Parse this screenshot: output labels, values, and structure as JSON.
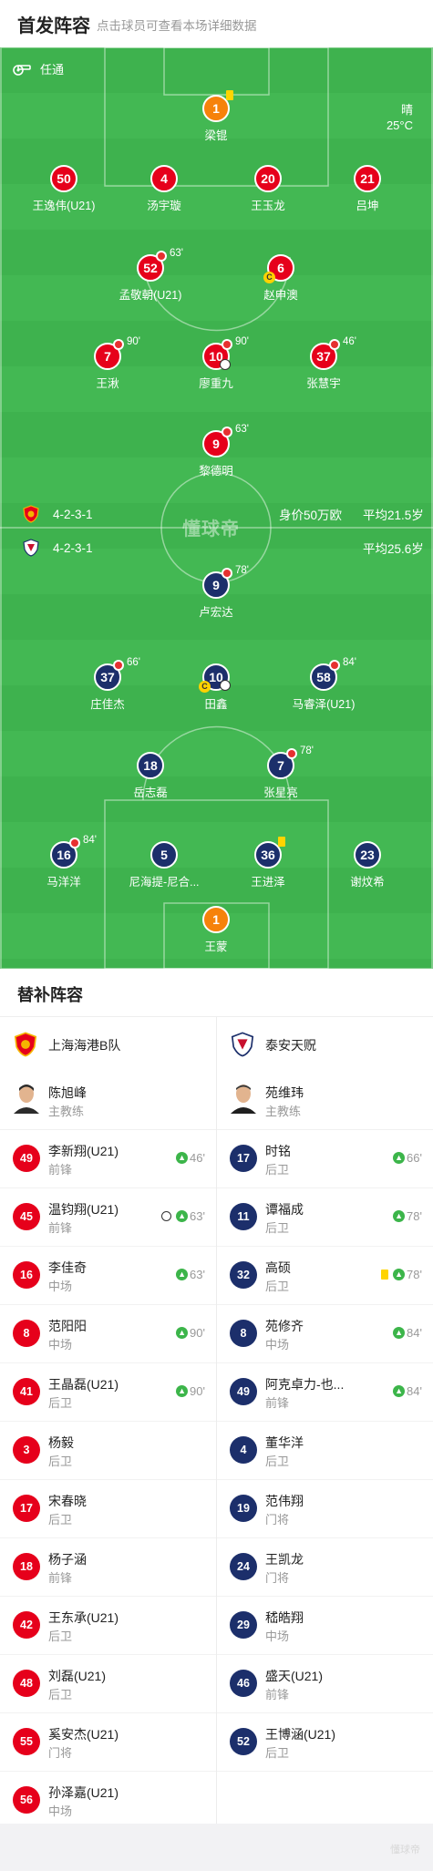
{
  "header": {
    "title": "首发阵容",
    "subtitle": "点击球员可查看本场详细数据"
  },
  "referee": {
    "icon": "whistle-icon",
    "name": "任通"
  },
  "weather": {
    "condition": "晴",
    "temperature": "25°C"
  },
  "watermark": "懂球帝",
  "home_team": {
    "formation": "4-2-3-1",
    "value": "身价50万欧",
    "avg_age": "平均21.5岁"
  },
  "away_team": {
    "formation": "4-2-3-1",
    "avg_age": "平均25.6岁"
  },
  "home_players": [
    {
      "num": "1",
      "name": "梁锟"
    },
    {
      "num": "50",
      "name": "王逸伟(U21)"
    },
    {
      "num": "4",
      "name": "汤宇璇"
    },
    {
      "num": "20",
      "name": "王玉龙"
    },
    {
      "num": "21",
      "name": "吕坤"
    },
    {
      "num": "52",
      "name": "孟敬朝(U21)",
      "sub": "63'"
    },
    {
      "num": "6",
      "name": "赵申澳"
    },
    {
      "num": "7",
      "name": "王湫",
      "sub": "90'"
    },
    {
      "num": "10",
      "name": "廖重九",
      "sub": "90'"
    },
    {
      "num": "37",
      "name": "张慧宇",
      "sub": "46'"
    },
    {
      "num": "9",
      "name": "黎德明",
      "sub": "63'"
    }
  ],
  "away_players": [
    {
      "num": "9",
      "name": "卢宏达",
      "sub": "78'"
    },
    {
      "num": "37",
      "name": "庄佳杰",
      "sub": "66'"
    },
    {
      "num": "10",
      "name": "田鑫"
    },
    {
      "num": "58",
      "name": "马睿泽(U21)",
      "sub": "84'"
    },
    {
      "num": "18",
      "name": "岳志磊"
    },
    {
      "num": "7",
      "name": "张星亮",
      "sub": "78'"
    },
    {
      "num": "16",
      "name": "马洋洋",
      "sub": "84'"
    },
    {
      "num": "5",
      "name": "尼海提-尼合..."
    },
    {
      "num": "36",
      "name": "王进泽"
    },
    {
      "num": "23",
      "name": "谢炆希"
    },
    {
      "num": "1",
      "name": "王蒙"
    }
  ],
  "subs_section": {
    "title": "替补阵容",
    "home": {
      "team_name": "上海海港B队",
      "coach": {
        "name": "陈旭峰",
        "role": "主教练"
      },
      "players": [
        {
          "num": "49",
          "name": "李新翔(U21)",
          "pos": "前锋",
          "in": "46'"
        },
        {
          "num": "45",
          "name": "温钧翔(U21)",
          "pos": "前锋",
          "in": "63'",
          "goal": true
        },
        {
          "num": "16",
          "name": "李佳奇",
          "pos": "中场",
          "in": "63'"
        },
        {
          "num": "8",
          "name": "范阳阳",
          "pos": "中场",
          "in": "90'"
        },
        {
          "num": "41",
          "name": "王晶磊(U21)",
          "pos": "后卫",
          "in": "90'"
        },
        {
          "num": "3",
          "name": "杨毅",
          "pos": "后卫"
        },
        {
          "num": "17",
          "name": "宋春晓",
          "pos": "后卫"
        },
        {
          "num": "18",
          "name": "杨子涵",
          "pos": "前锋"
        },
        {
          "num": "42",
          "name": "王东承(U21)",
          "pos": "后卫"
        },
        {
          "num": "48",
          "name": "刘磊(U21)",
          "pos": "后卫"
        },
        {
          "num": "55",
          "name": "奚安杰(U21)",
          "pos": "门将"
        },
        {
          "num": "56",
          "name": "孙泽嘉(U21)",
          "pos": "中场"
        }
      ]
    },
    "away": {
      "team_name": "泰安天贶",
      "coach": {
        "name": "苑维玮",
        "role": "主教练"
      },
      "players": [
        {
          "num": "17",
          "name": "时铭",
          "pos": "后卫",
          "in": "66'"
        },
        {
          "num": "11",
          "name": "谭福成",
          "pos": "后卫",
          "in": "78'"
        },
        {
          "num": "32",
          "name": "高硕",
          "pos": "后卫",
          "in": "78'",
          "yellow": true
        },
        {
          "num": "8",
          "name": "苑修齐",
          "pos": "中场",
          "in": "84'"
        },
        {
          "num": "49",
          "name": "阿克卓力-也...",
          "pos": "前锋",
          "in": "84'"
        },
        {
          "num": "4",
          "name": "董华洋",
          "pos": "后卫"
        },
        {
          "num": "19",
          "name": "范伟翔",
          "pos": "门将"
        },
        {
          "num": "24",
          "name": "王凯龙",
          "pos": "门将"
        },
        {
          "num": "29",
          "name": "嵇皓翔",
          "pos": "中场"
        },
        {
          "num": "46",
          "name": "盛天(U21)",
          "pos": "前锋"
        },
        {
          "num": "52",
          "name": "王博涵(U21)",
          "pos": "后卫"
        }
      ]
    }
  },
  "footer_mark": "懂球帝",
  "colors": {
    "home": "#e6001b",
    "away": "#1c2f6b",
    "keeper_home": "#f6820b",
    "pitch": "#43b853"
  }
}
